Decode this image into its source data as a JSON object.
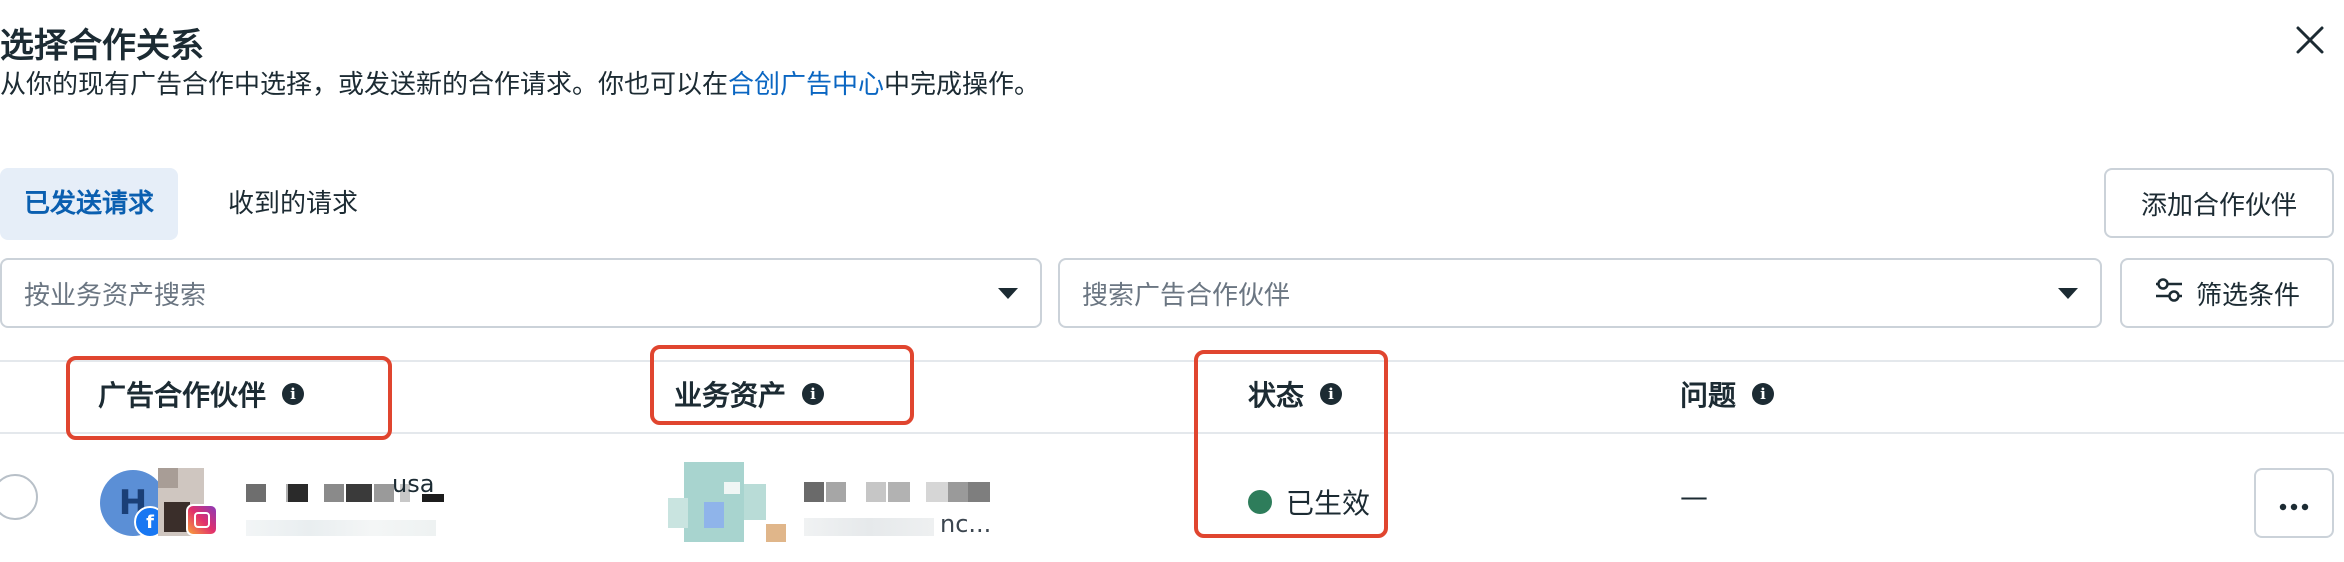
{
  "dialog": {
    "title": "选择合作关系",
    "subtitle_before": "从你的现有广告合作中选择，或发送新的合作请求。你也可以在",
    "subtitle_link": "合创广告中心",
    "subtitle_after": "中完成操作。"
  },
  "tabs": [
    {
      "label": "已发送请求",
      "active": true
    },
    {
      "label": "收到的请求",
      "active": false
    }
  ],
  "toolbar": {
    "add_partner_label": "添加合作伙伴",
    "filter_label": "筛选条件"
  },
  "search": {
    "asset_placeholder": "按业务资产搜索",
    "partner_placeholder": "搜索广告合作伙伴"
  },
  "table": {
    "columns": [
      "广告合作伙伴",
      "业务资产",
      "状态",
      "问题"
    ],
    "rows": [
      {
        "avatar_letter": "H",
        "partner_name_fragment": "usa",
        "asset_name_fragment": "nc...",
        "status": "已生效",
        "issues": "—"
      }
    ]
  },
  "colors": {
    "accent": "#0a66c2",
    "active_tab_bg": "#e6eef8",
    "highlight": "#e0452f",
    "status_active": "#2e7d5b"
  },
  "icons": {
    "close": "close-icon",
    "caret": "caret-down-icon",
    "info": "info-icon",
    "filter": "sliders-icon",
    "more": "more-horizontal-icon"
  }
}
